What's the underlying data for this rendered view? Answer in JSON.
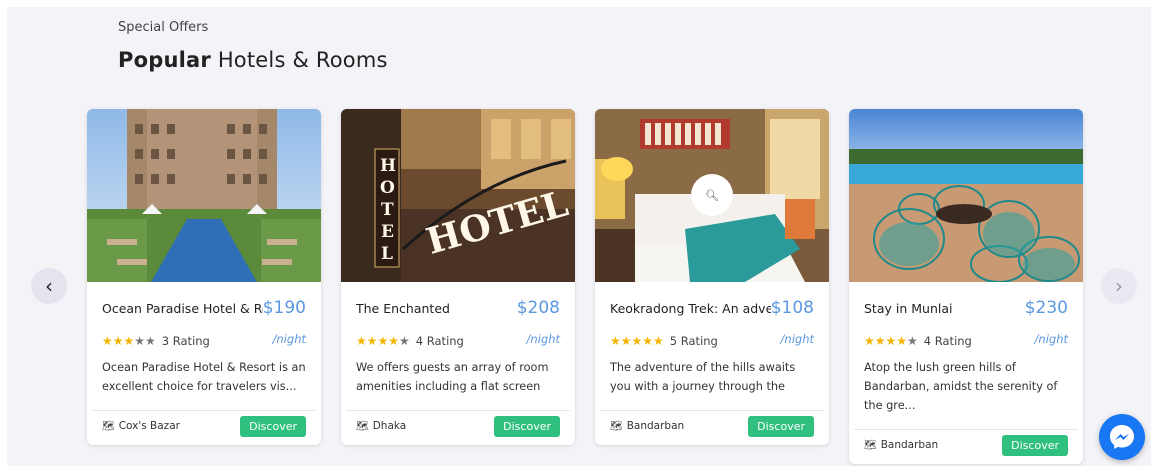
{
  "header": {
    "subtitle": "Special Offers",
    "title_bold": "Popular",
    "title_rest": " Hotels & Rooms"
  },
  "carousel": {
    "prev_label": "‹",
    "next_label": "›"
  },
  "cards": [
    {
      "title": "Ocean Paradise Hotel & Re",
      "price": "$190",
      "per": "/night",
      "stars_on": "★★★",
      "stars_off": "★★",
      "rating": "3 Rating",
      "desc": "Ocean Paradise Hotel & Resort is an excellent choice for travelers vis...",
      "location": "Cox's Bazar",
      "button": "Discover"
    },
    {
      "title": "The Enchanted",
      "price": "$208",
      "per": "/night",
      "stars_on": "★★★★",
      "stars_off": "★",
      "rating": "4 Rating",
      "desc": "We offers guests an array of room amenities including a flat screen TV...",
      "location": "Dhaka",
      "button": "Discover",
      "image_sign": "HOTEL"
    },
    {
      "title": "Keokradong Trek: An adven",
      "price": "$108",
      "per": "/night",
      "stars_on": "★★★★★",
      "stars_off": "",
      "rating": "5 Rating",
      "desc": "The adventure of the hills awaits you with a journey through the highe...",
      "location": "Bandarban",
      "button": "Discover"
    },
    {
      "title": "Stay in Munlai",
      "price": "$230",
      "per": "/night",
      "stars_on": "★★★★",
      "stars_off": "★",
      "rating": "4 Rating",
      "desc": "Atop the lush green hills of Bandarban, amidst the serenity of the gre...",
      "location": "Bandarban",
      "button": "Discover"
    }
  ],
  "icons": {
    "map": "map-icon",
    "zoom": "search-icon",
    "chat": "messenger-icon"
  },
  "colors": {
    "price": "#5a98e0",
    "button": "#2fbf7f",
    "star": "#f4b400",
    "messenger": "#1877f2"
  }
}
